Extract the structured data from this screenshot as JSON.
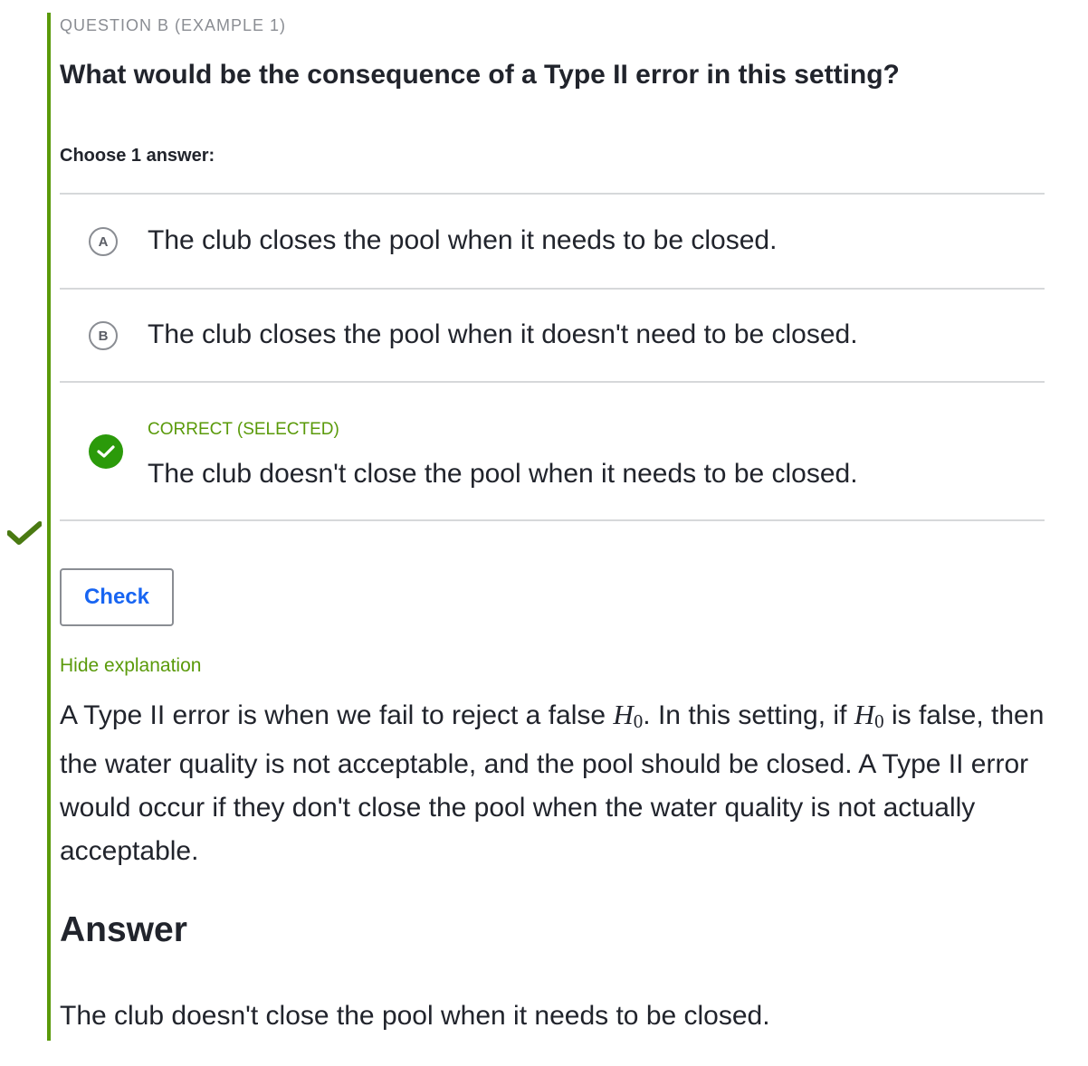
{
  "question": {
    "label": "QUESTION B (EXAMPLE 1)",
    "title": "What would be the consequence of a Type II error in this setting?",
    "choose_label": "Choose 1 answer:"
  },
  "choices": [
    {
      "letter": "A",
      "text": "The club closes the pool when it needs to be closed."
    },
    {
      "letter": "B",
      "text": "The club closes the pool when it doesn't need to be closed."
    },
    {
      "status": "CORRECT (SELECTED)",
      "text": "The club doesn't close the pool when it needs to be closed.",
      "icon": "checkmark-circle-icon"
    }
  ],
  "check_button": {
    "label": "Check"
  },
  "explanation": {
    "toggle_label": "Hide explanation",
    "part1": "A Type II error is when we fail to reject a false ",
    "math_var": "H",
    "math_sub": "0",
    "part2": ". In this setting, if ",
    "part3": " is false, then the water quality is not acceptable, and the pool should be closed. A Type II error would occur if they don't close the pool when the water quality is not actually acceptable."
  },
  "answer": {
    "heading": "Answer",
    "text": "The club doesn't close the pool when it needs to be closed."
  },
  "colors": {
    "accent_green": "#5a9a0a",
    "correct_green": "#2b9a0a",
    "link_blue": "#1865f2",
    "divider": "#d6d8da"
  }
}
